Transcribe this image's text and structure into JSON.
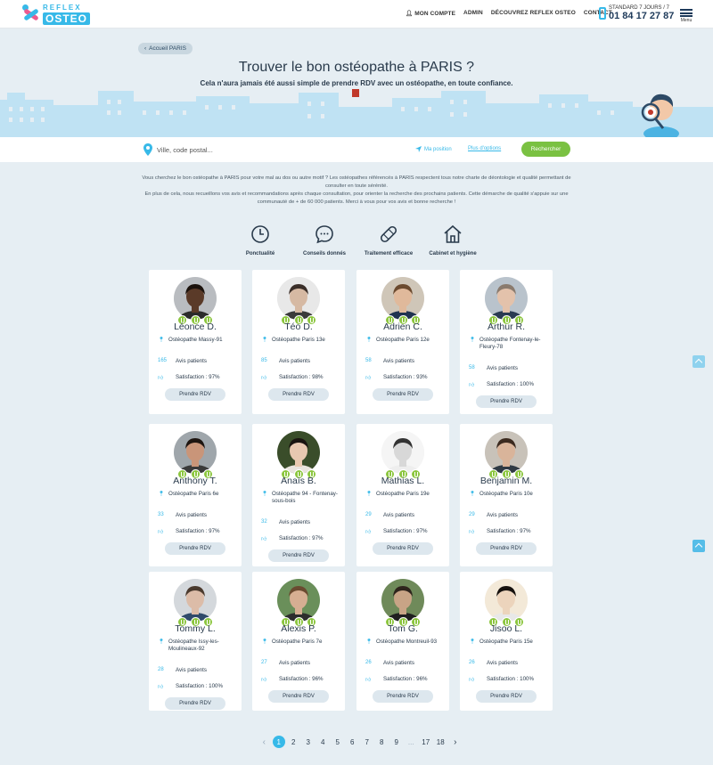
{
  "header": {
    "logo_top": "REFLEX",
    "logo_bottom": "OSTEO",
    "nav": [
      "MON COMPTE",
      "ADMIN",
      "DÉCOUVREZ REFLEX OSTEO",
      "CONTACT"
    ],
    "phone_label": "STANDARD 7 JOURS / 7",
    "phone_number": "01 84 17 27 87",
    "menu_label": "Menu"
  },
  "hero": {
    "back_label": "Accueil PARIS",
    "title": "Trouver le bon ostéopathe à PARIS ?",
    "subtitle": "Cela n'aura jamais été aussi simple de prendre RDV avec un ostéopathe, en toute confiance."
  },
  "search": {
    "placeholder": "Ville, code postal...",
    "my_position": "Ma position",
    "more_options": "Plus d'options",
    "button": "Rechercher"
  },
  "intro": {
    "line1": "Vous cherchez le bon ostéopathe à PARIS pour votre mal au dos ou autre motif ? Les ostéopathes référencés à PARIS respectent tous notre charte de déontologie et qualité permettant de consulter en toute sérénité.",
    "line2": "En plus de cela, nous recueillons vos avis et recommandations après chaque consultation, pour orienter la recherche des prochains patients. Cette démarche de qualité s'appuie sur une communauté de + de 60 000 patients. Merci à vous pour vos avis et bonne recherche !"
  },
  "features": [
    {
      "label": "Ponctualité",
      "icon": "clock-icon"
    },
    {
      "label": "Conseils donnés",
      "icon": "chat-bubble-icon"
    },
    {
      "label": "Traitement efficace",
      "icon": "bandage-icon"
    },
    {
      "label": "Cabinet et hygiène",
      "icon": "house-icon"
    }
  ],
  "cards_common": {
    "reviews_label": "Avis patients",
    "satisfaction_prefix": "Satisfaction : ",
    "rdv_label": "Prendre RDV"
  },
  "practitioners": [
    {
      "name": "Léonce D.",
      "location": "Ostéopathe Massy-91",
      "reviews": "165",
      "satisfaction": "Satisfaction : 97%",
      "skin": "#5a3a28",
      "hair": "#1b120c",
      "bg": "#b9bcc0",
      "shirt": "#2b2b2b"
    },
    {
      "name": "Téo D.",
      "location": "Ostéopathe Paris 13e",
      "reviews": "85",
      "satisfaction": "Satisfaction : 98%",
      "skin": "#d6b9a3",
      "hair": "#3a2e28",
      "bg": "#e8e8e8",
      "shirt": "#3b3b3b"
    },
    {
      "name": "Adrien C.",
      "location": "Ostéopathe Paris 12e",
      "reviews": "58",
      "satisfaction": "Satisfaction : 93%",
      "skin": "#e0b99b",
      "hair": "#6b4a2f",
      "bg": "#cfc6b8",
      "shirt": "#1f3350"
    },
    {
      "name": "Arthur R.",
      "location": "Ostéopathe Fontenay-le-Fleury-78",
      "reviews": "58",
      "satisfaction": "Satisfaction : 100%",
      "skin": "#e3c2ab",
      "hair": "#8a7b6e",
      "bg": "#b9c3cc",
      "shirt": "#2a3b52"
    },
    {
      "name": "Anthony T.",
      "location": "Ostéopathe Paris 6e",
      "reviews": "33",
      "satisfaction": "Satisfaction : 97%",
      "skin": "#c99579",
      "hair": "#1e1510",
      "bg": "#9fa6ab",
      "shirt": "#3a3a3a"
    },
    {
      "name": "Anaïs B.",
      "location": "Ostéopathe 94 - Fontenay-sous-bois",
      "reviews": "32",
      "satisfaction": "Satisfaction : 97%",
      "skin": "#e8c8b0",
      "hair": "#1a1410",
      "bg": "#3a4d2a",
      "shirt": "#e9e4de"
    },
    {
      "name": "Mathias L.",
      "location": "Ostéopathe Paris 19e",
      "reviews": "29",
      "satisfaction": "Satisfaction : 97%",
      "skin": "#d8d8d8",
      "hair": "#333333",
      "bg": "#f5f5f5",
      "shirt": "#eeeeee"
    },
    {
      "name": "Benjamin M.",
      "location": "Ostéopathe Paris 10e",
      "reviews": "29",
      "satisfaction": "Satisfaction : 97%",
      "skin": "#d9b49a",
      "hair": "#3b2a1f",
      "bg": "#c8c2b9",
      "shirt": "#2f3a44"
    },
    {
      "name": "Tommy L.",
      "location": "Ostéopathe Issy-les-Moulineaux-92",
      "reviews": "28",
      "satisfaction": "Satisfaction : 100%",
      "skin": "#dcbca8",
      "hair": "#4a3a2e",
      "bg": "#d4d8dc",
      "shirt": "#2f4a6a"
    },
    {
      "name": "Alexis P.",
      "location": "Ostéopathe Paris 7e",
      "reviews": "27",
      "satisfaction": "Satisfaction : 96%",
      "skin": "#d6ae92",
      "hair": "#6a4a30",
      "bg": "#6a8f5a",
      "shirt": "#2d2d2d"
    },
    {
      "name": "Tom G.",
      "location": "Ostéopathe Montreuil-93",
      "reviews": "26",
      "satisfaction": "Satisfaction : 96%",
      "skin": "#c8a486",
      "hair": "#2e241c",
      "bg": "#6f8a5a",
      "shirt": "#1f1f1f"
    },
    {
      "name": "Jisoo L.",
      "location": "Ostéopathe Paris 15e",
      "reviews": "26",
      "satisfaction": "Satisfaction : 100%",
      "skin": "#ecd4bc",
      "hair": "#15110e",
      "bg": "#f3e9d8",
      "shirt": "#e8e8e8"
    }
  ],
  "pagination": {
    "pages": [
      "1",
      "2",
      "3",
      "4",
      "5",
      "6",
      "7",
      "8",
      "9",
      "...",
      "17",
      "18"
    ],
    "current": "1",
    "prev": "‹",
    "next": "›"
  },
  "colors": {
    "accent": "#37b9e8",
    "green": "#7ac142",
    "background": "#e6eef3",
    "text": "#2a3b4c"
  }
}
